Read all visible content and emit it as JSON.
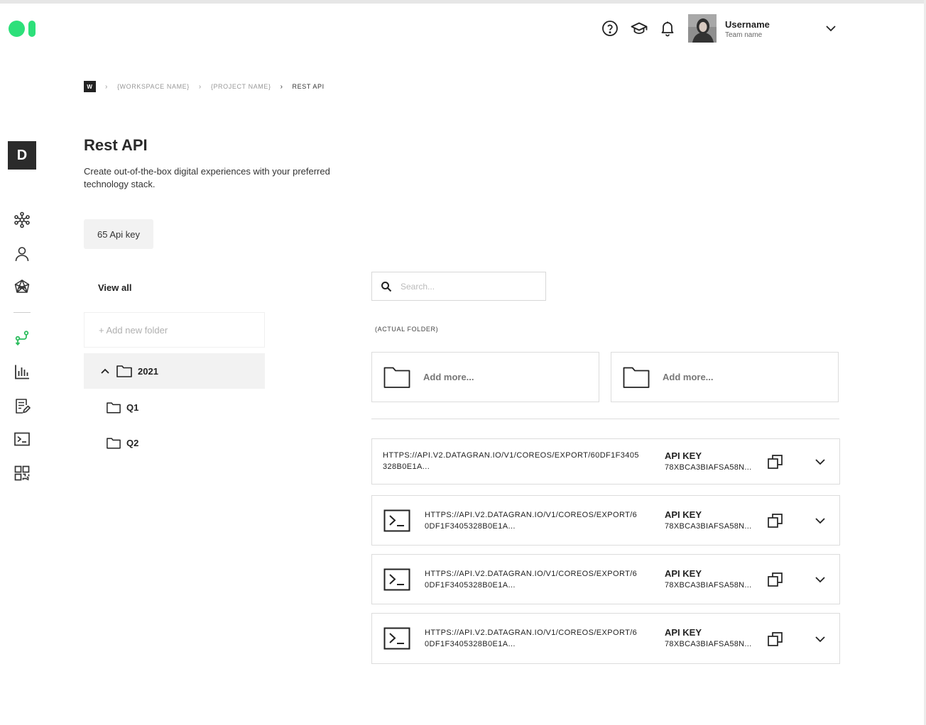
{
  "header": {
    "logo": "brand-logo",
    "icons": [
      "help-circle-icon",
      "graduation-cap-icon",
      "bell-icon"
    ],
    "user": {
      "name": "Username",
      "team": "Team name"
    }
  },
  "breadcrumb": {
    "workspace_badge": "W",
    "separator": "›",
    "items": [
      "{WORKSPACE NAME}",
      "{PROJECT NAME}",
      "REST API"
    ]
  },
  "rail": {
    "badge": "D",
    "items": [
      "network-icon",
      "user-icon",
      "polyhedron-icon",
      "branch-icon",
      "bar-chart-icon",
      "document-edit-icon",
      "terminal-icon",
      "qr-code-icon"
    ],
    "active_color": "#2dbd5e"
  },
  "page": {
    "title": "Rest API",
    "description": "Create out-of-the-box digital experiences with your preferred technology stack.",
    "api_count_label": "65 Api key"
  },
  "folders": {
    "view_all": "View all",
    "add_new": "+ Add new folder",
    "tree": [
      {
        "label": "2021",
        "expanded": true,
        "children": [
          {
            "label": "Q1"
          },
          {
            "label": "Q2"
          }
        ]
      }
    ]
  },
  "search": {
    "placeholder": "Search..."
  },
  "actual_folder": {
    "heading": "(ACTUAL FOLDER)",
    "cards": [
      {
        "label": "Add more..."
      },
      {
        "label": "Add more..."
      }
    ]
  },
  "api_rows": [
    {
      "url_line1": "HTTPS://API.V2.DATAGRAN.IO/V1/COREOS/EXPORT/60DF1F3405",
      "url_line2": "328B0E1A...",
      "key_label": "API KEY",
      "key_value": "78XBCA3BIAFSA58N...",
      "has_terminal_icon": false
    },
    {
      "url_line1": "HTTPS://API.V2.DATAGRAN.IO/V1/COREOS/EXPORT/6",
      "url_line2": "0DF1F3405328B0E1A...",
      "key_label": "API KEY",
      "key_value": "78XBCA3BIAFSA58N...",
      "has_terminal_icon": true
    },
    {
      "url_line1": "HTTPS://API.V2.DATAGRAN.IO/V1/COREOS/EXPORT/6",
      "url_line2": "0DF1F3405328B0E1A...",
      "key_label": "API KEY",
      "key_value": "78XBCA3BIAFSA58N...",
      "has_terminal_icon": true
    },
    {
      "url_line1": "HTTPS://API.V2.DATAGRAN.IO/V1/COREOS/EXPORT/6",
      "url_line2": "0DF1F3405328B0E1A...",
      "key_label": "API KEY",
      "key_value": "78XBCA3BIAFSA58N...",
      "has_terminal_icon": true
    }
  ],
  "colors": {
    "brand": "#2de07a",
    "text": "#222222",
    "muted": "#999999",
    "border": "#dcdcdc"
  }
}
